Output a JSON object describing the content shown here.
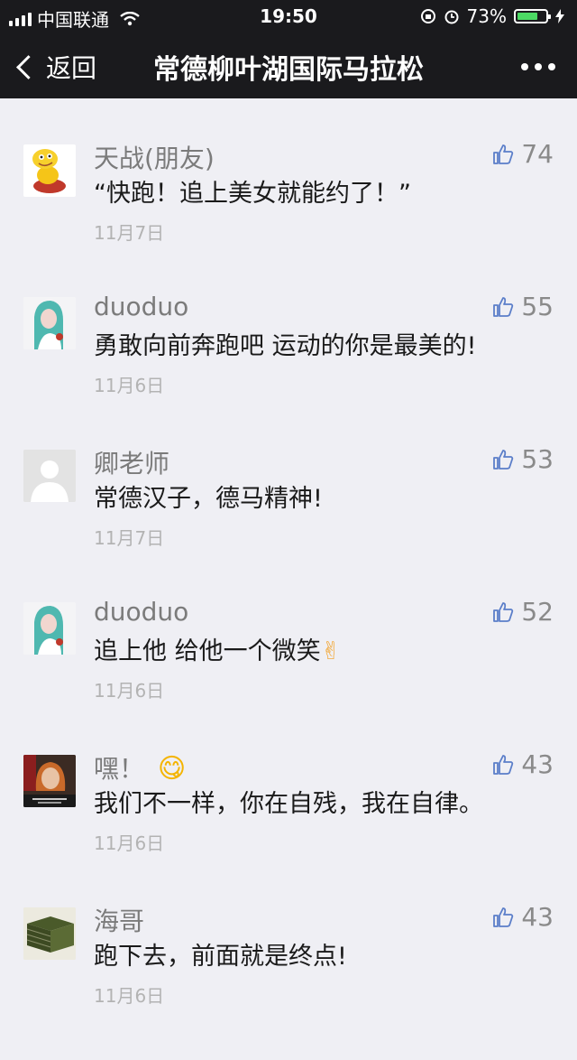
{
  "status_bar": {
    "carrier": "中国联通",
    "time": "19:50",
    "battery": "73%",
    "battery_level": 0.73
  },
  "nav": {
    "back_label": "返回",
    "title": "常德柳叶湖国际马拉松"
  },
  "comments": [
    {
      "name": "天战(朋友)",
      "text": "“快跑！追上美女就能约了！”",
      "date": "11月7日",
      "likes": "74",
      "avatar": "cartoon-snake"
    },
    {
      "name": "duoduo",
      "text": "勇敢向前奔跑吧 运动的你是最美的!",
      "date": "11月6日",
      "likes": "55",
      "avatar": "girl-photo"
    },
    {
      "name": "卿老师",
      "text": "常德汉子，德马精神!",
      "date": "11月7日",
      "likes": "53",
      "avatar": "default-person"
    },
    {
      "name": "duoduo",
      "text": "追上他  给他一个微笑",
      "emoji": "✌",
      "date": "11月6日",
      "likes": "52",
      "avatar": "girl-photo"
    },
    {
      "name": "嘿！",
      "emoji": "😋",
      "text": "我们不一样，你在自残，我在自律。",
      "date": "11月6日",
      "likes": "43",
      "avatar": "painting-portrait"
    },
    {
      "name": "海哥",
      "text": "跑下去，前面就是终点!",
      "date": "11月6日",
      "likes": "43",
      "avatar": "book-stack"
    }
  ],
  "colors": {
    "topbar": "#1a1a1d",
    "background": "#efeff4",
    "name": "#7b7b7b",
    "date": "#b3b3b3",
    "battery_fill": "#4cd964"
  }
}
